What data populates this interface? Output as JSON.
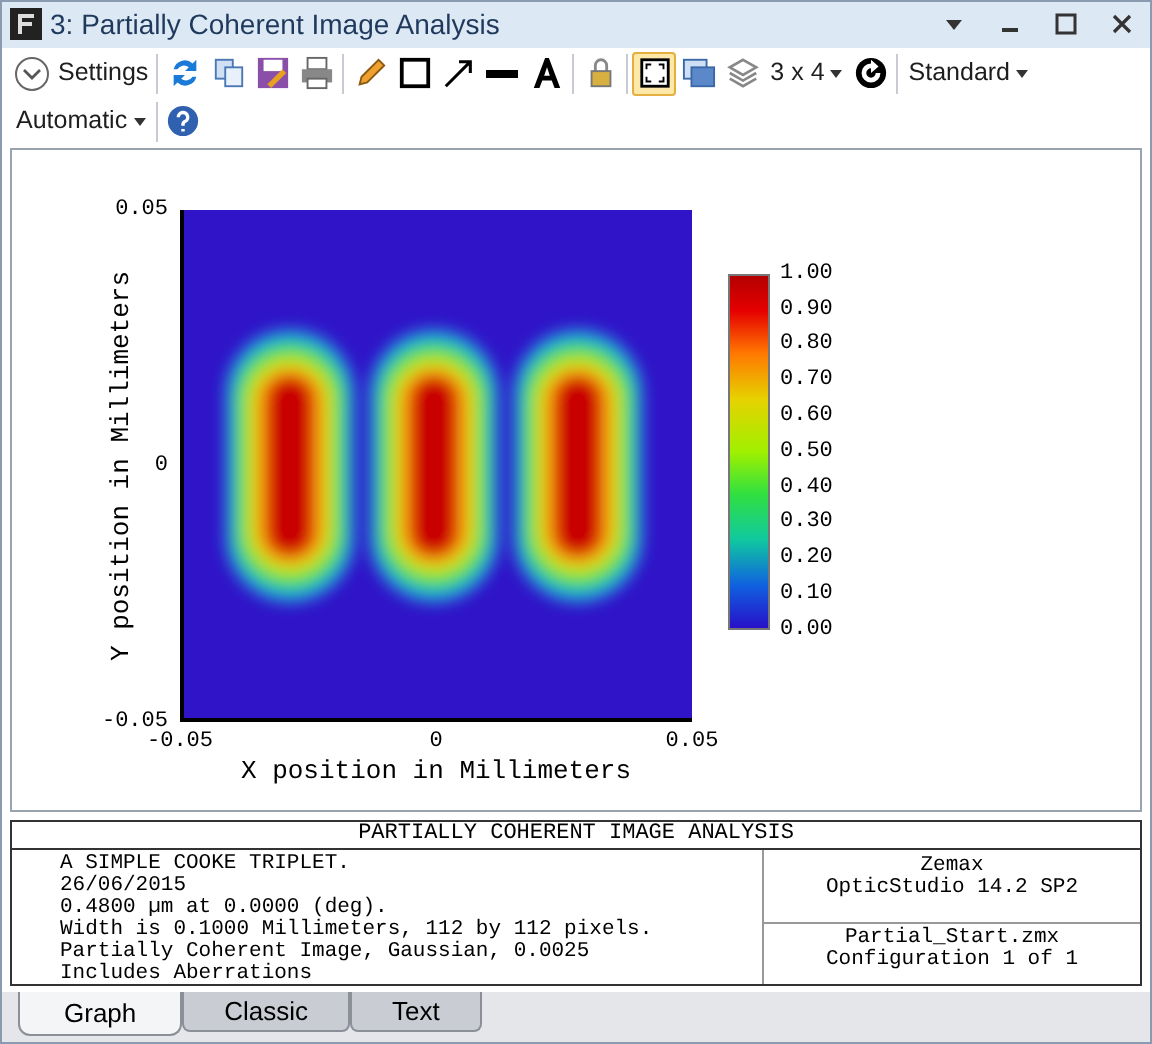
{
  "window": {
    "title": "3: Partially Coherent Image Analysis"
  },
  "toolbar": [
    {
      "kind": "settings",
      "label": "Settings"
    },
    {
      "kind": "sep"
    },
    {
      "kind": "refresh",
      "on": false
    },
    {
      "kind": "copy",
      "on": false
    },
    {
      "kind": "save",
      "on": false
    },
    {
      "kind": "print",
      "on": false
    },
    {
      "kind": "sep"
    },
    {
      "kind": "pencil",
      "on": false
    },
    {
      "kind": "rect",
      "on": false
    },
    {
      "kind": "arrow",
      "on": false
    },
    {
      "kind": "line",
      "on": false
    },
    {
      "kind": "text-tool",
      "on": false
    },
    {
      "kind": "sep"
    },
    {
      "kind": "lock",
      "on": false
    },
    {
      "kind": "sep"
    },
    {
      "kind": "fit",
      "on": true
    },
    {
      "kind": "windows",
      "on": false
    },
    {
      "kind": "layers",
      "on": false
    },
    {
      "kind": "dropdown",
      "label": "3 x 4"
    },
    {
      "kind": "rotate",
      "on": false
    },
    {
      "kind": "sep"
    },
    {
      "kind": "dropdown",
      "label": "Standard"
    },
    {
      "kind": "dropdown",
      "label": "Automatic"
    },
    {
      "kind": "sep"
    },
    {
      "kind": "help",
      "on": false
    }
  ],
  "plot": {
    "y_ticks": [
      "0.05",
      "0",
      "-0.05"
    ],
    "x_ticks": [
      "-0.05",
      "0",
      "0.05"
    ],
    "xlabel": "X position in Millimeters",
    "ylabel": "Y position in Millimeters",
    "colorbar": [
      "1.00",
      "0.90",
      "0.80",
      "0.70",
      "0.60",
      "0.50",
      "0.40",
      "0.30",
      "0.20",
      "0.10",
      "0.00"
    ]
  },
  "info": {
    "title": "PARTIALLY COHERENT IMAGE ANALYSIS",
    "lines": [
      "A SIMPLE COOKE TRIPLET.",
      "26/06/2015",
      "0.4800 µm at 0.0000 (deg).",
      "Width is 0.1000 Millimeters, 112 by 112 pixels.",
      "Partially Coherent Image, Gaussian, 0.0025",
      "Includes Aberrations"
    ],
    "program": [
      "Zemax",
      "OpticStudio 14.2 SP2"
    ],
    "file": [
      "Partial_Start.zmx",
      "Configuration 1 of 1"
    ]
  },
  "tabs": [
    {
      "label": "Graph",
      "selected": true
    },
    {
      "label": "Classic",
      "selected": false
    },
    {
      "label": "Text",
      "selected": false
    }
  ]
}
